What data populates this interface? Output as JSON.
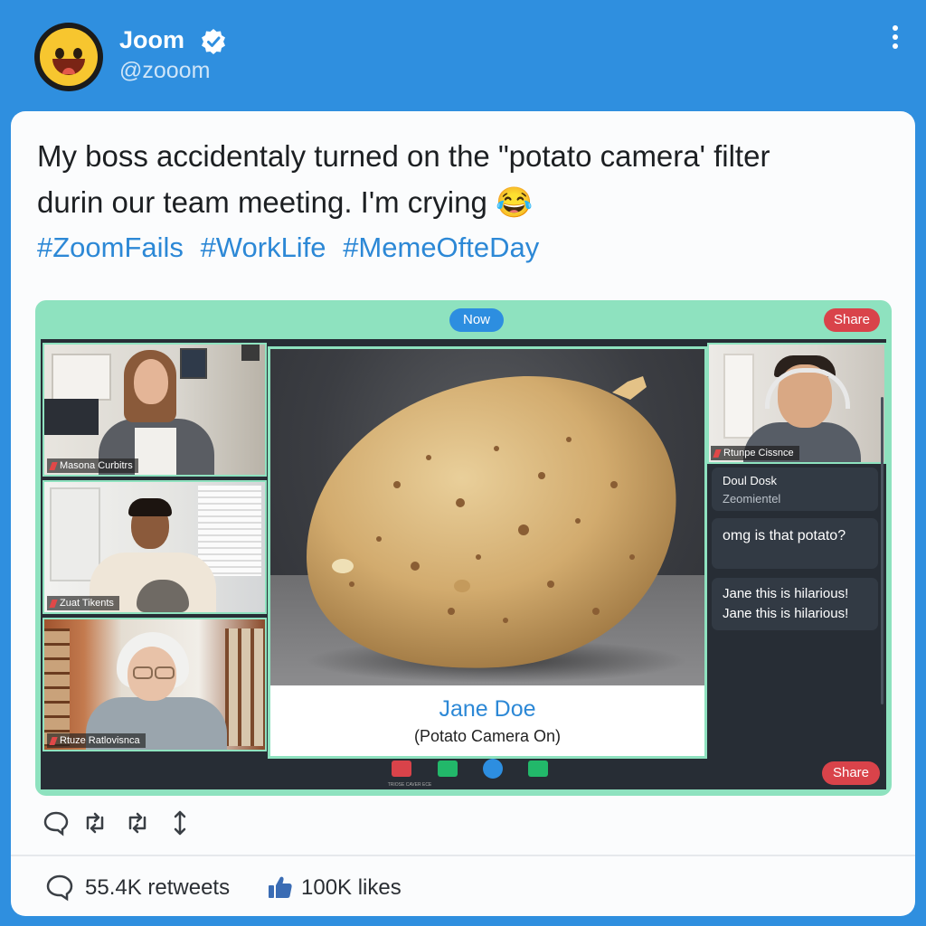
{
  "author": {
    "name": "Joom",
    "handle": "@zooom",
    "verified": true,
    "avatar": "grinning-face-emoji"
  },
  "tweet": {
    "line1": "My boss accidentaly turned on the \"potato camera' filter",
    "line2": "durin our team meeting. I'm crying",
    "emoji": "😂",
    "hashtags": [
      "#ZoomFails",
      "#WorkLife",
      "#MemeOfteDay"
    ]
  },
  "meeting": {
    "now_label": "Now",
    "share_label_top": "Share",
    "share_label_bottom": "Share",
    "participants": [
      {
        "name": "Masona Curbitrs"
      },
      {
        "name": "Zuat Tikents"
      },
      {
        "name": "Rtuze Ratlovisnca"
      }
    ],
    "main": {
      "name": "Jane Doe",
      "status": "(Potato Camera On)"
    },
    "right_participant": {
      "name": "Rtunpe Cissnce"
    },
    "chat": {
      "header_line1": "Doul Dosk",
      "header_line2": "Zeomientel",
      "messages": [
        "omg is that potato?",
        "Jane this is hilarious!",
        "Jane this is hilarious!"
      ]
    },
    "toolbar": {
      "icons": [
        "video-icon",
        "reaction-icon",
        "record-icon",
        "apps-icon"
      ],
      "caption": "TRIOSE CAVER ECE"
    }
  },
  "stats": {
    "retweets": "55.4K retweets",
    "likes": "100K likes"
  },
  "colors": {
    "background": "#2f8fdf",
    "accent": "#2c88d6",
    "zoom_frame": "#8ee2bf",
    "share": "#d9434a"
  }
}
